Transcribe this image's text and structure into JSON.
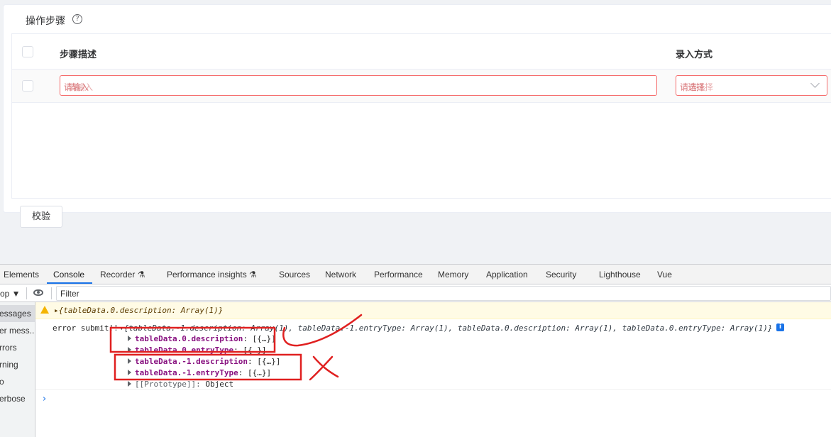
{
  "card": {
    "title": "操作步骤",
    "help_icon": "question-circle-icon",
    "table": {
      "columns": [
        "步骤描述",
        "录入方式"
      ],
      "row": {
        "description_placeholder": "请输入",
        "description_overlap": "请输入",
        "entry_placeholder": "请选择",
        "entry_overlap": "请选择"
      }
    },
    "validate_button": "校验"
  },
  "devtools": {
    "tabs": [
      {
        "label": "Elements"
      },
      {
        "label": "Console",
        "active": true
      },
      {
        "label": "Recorder ⚗"
      },
      {
        "label": "Performance insights ⚗"
      },
      {
        "label": "Sources"
      },
      {
        "label": "Network"
      },
      {
        "label": "Performance"
      },
      {
        "label": "Memory"
      },
      {
        "label": "Application"
      },
      {
        "label": "Security"
      },
      {
        "label": "Lighthouse"
      },
      {
        "label": "Vue"
      }
    ],
    "toolbar": {
      "context": "op ▼",
      "filter_placeholder": "Filter"
    },
    "sidebar": [
      "essages",
      "er mess...",
      "rrors",
      "rning",
      "o",
      "erbose"
    ],
    "console": {
      "warning": "▸{tableData.0.description: Array(1)}",
      "log_prefix": "error submit!!",
      "log_summary": "▾{tableData.-1.description: Array(1), tableData.-1.entryType: Array(1), tableData.0.description: Array(1), tableData.0.entryType: Array(1)}",
      "entries": [
        {
          "key": "tableData.0.description",
          "value": "[{…}]"
        },
        {
          "key": "tableData.0.entryType",
          "value": "[{…}]"
        },
        {
          "key": "tableData.-1.description",
          "value": "[{…}]"
        },
        {
          "key": "tableData.-1.entryType",
          "value": "[{…}]"
        },
        {
          "key": "[[Prototype]]",
          "value": "Object"
        }
      ],
      "prompt": "›"
    }
  },
  "colors": {
    "error_border": "#f56c6c",
    "annotation_red": "#e02020",
    "devtools_accent": "#1a73e8"
  }
}
